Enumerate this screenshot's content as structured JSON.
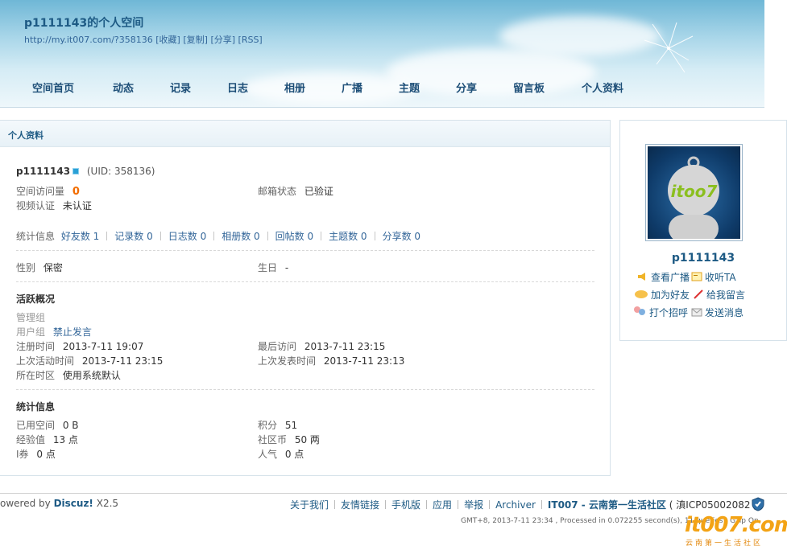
{
  "header": {
    "title": "p1111143的个人空间",
    "url": "http://my.it007.com/?358136",
    "link_favorite": "[收藏]",
    "link_copy": "[复制]",
    "link_share": "[分享]",
    "link_rss": "[RSS]"
  },
  "nav": {
    "items": [
      "空间首页",
      "动态",
      "记录",
      "日志",
      "相册",
      "广播",
      "主题",
      "分享",
      "留言板",
      "个人资料"
    ]
  },
  "main": {
    "section_title": "个人资料",
    "username": "p1111143",
    "uid": "(UID: 358136)",
    "visits_label": "空间访问量",
    "visits_value": "0",
    "email_label": "邮箱状态",
    "email_value": "已验证",
    "video_label": "视频认证",
    "video_value": "未认证",
    "stats_label": "统计信息",
    "stats": [
      "好友数 1",
      "记录数 0",
      "日志数 0",
      "相册数 0",
      "回帖数 0",
      "主题数 0",
      "分享数 0"
    ],
    "gender_label": "性别",
    "gender_value": "保密",
    "birthday_label": "生日",
    "birthday_value": "-",
    "activity_title": "活跃概况",
    "admin_group_label": "管理组",
    "user_group_label": "用户组",
    "user_group_value": "禁止发言",
    "reg_label": "注册时间",
    "reg_value": "2013-7-11 19:07",
    "last_visit_label": "最后访问",
    "last_visit_value": "2013-7-11 23:15",
    "last_active_label": "上次活动时间",
    "last_active_value": "2013-7-11 23:15",
    "last_post_label": "上次发表时间",
    "last_post_value": "2013-7-11 23:13",
    "tz_label": "所在时区",
    "tz_value": "使用系统默认",
    "stat_title": "统计信息",
    "space_label": "已用空间",
    "space_value": "0 B",
    "credits_label": "积分",
    "credits_value": "51",
    "exp_label": "经验值",
    "exp_value": "13 点",
    "coins_label": "社区币",
    "coins_value": "50 两",
    "voucher_label": "I券",
    "voucher_value": "0 点",
    "pop_label": "人气",
    "pop_value": "0 点"
  },
  "side": {
    "username": "p1111143",
    "avatar_text": "itoo7",
    "actions": [
      "查看广播",
      "收听TA",
      "加为好友",
      "给我留言",
      "打个招呼",
      "发送消息"
    ]
  },
  "footer": {
    "powered_prefix": "owered by",
    "powered_brand": "Discuz!",
    "powered_version": "X2.5",
    "links": [
      "关于我们",
      "友情链接",
      "手机版",
      "应用",
      "举报",
      "Archiver"
    ],
    "site_name": "IT007 - 云南第一生活社区",
    "icp": "( 滇ICP05002082 )",
    "info": "GMT+8, 2013-7-11 23:34 , Processed in 0.072255 second(s), 11 queries , Gzip On.",
    "watermark": "it007.com",
    "watermark_sub": "云南第一生活社区"
  },
  "colors": {
    "accent": "#1d5a84",
    "link": "#336699",
    "visits_highlight": "#f26c00"
  }
}
